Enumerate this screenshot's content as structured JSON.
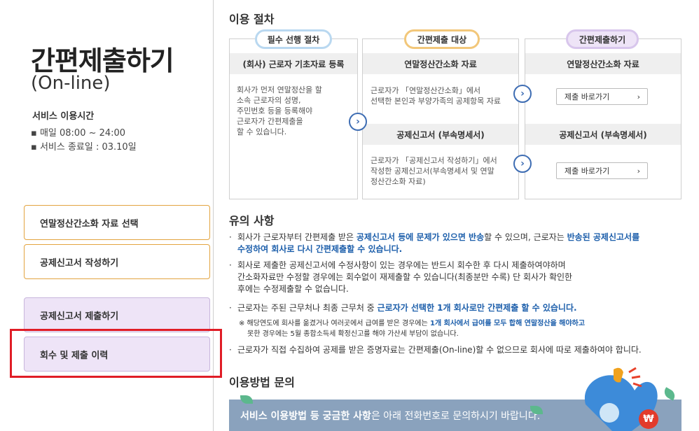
{
  "left": {
    "title": "간편제출하기",
    "subtitle": "(On-line)",
    "service_hours": {
      "heading": "서비스 이용시간",
      "lines": [
        "▪ 매일 08:00 ~ 24:00",
        "▪ 서비스 종료일 : 03.10일"
      ]
    },
    "menu": [
      "연말정산간소화 자료 선택",
      "공제신고서 작성하기",
      "공제신고서 제출하기",
      "회수 및 제출 이력"
    ]
  },
  "procedure": {
    "heading": "이용 절차",
    "pills": [
      "필수 선행 절차",
      "간편제출 대상",
      "간편제출하기"
    ],
    "col1": {
      "head": "(회사) 근로자 기초자료 등록",
      "text": [
        "회사가 먼저 연말정산을 할",
        "소속 근로자의 성명,",
        "주민번호 등을 등록해야",
        "근로자가 간편제출을",
        "할 수 있습니다."
      ]
    },
    "col2": {
      "head1": "연말정산간소화 자료",
      "text1": [
        "근로자가 「연말정산간소화」에서",
        "선택한 본인과 부양가족의 공제항목 자료"
      ],
      "head2": "공제신고서 (부속명세서)",
      "text2": [
        "근로자가 「공제신고서 작성하기」에서",
        "작성한 공제신고서(부속명세서 및 연말",
        "정산간소화 자료)"
      ]
    },
    "col3": {
      "head1": "연말정산간소화 자료",
      "head2": "공제신고서 (부속명세서)",
      "submit_label": "제출 바로가기",
      "chevron": "›"
    }
  },
  "notes": {
    "heading": "유의 사항",
    "n1": {
      "a": "회사가 근로자부터 간편제출 받은 ",
      "b": "공제신고서 등에 문제가 있으면 반송",
      "c": "할 수 있으며, 근로자는 ",
      "d": "반송된 공제신고서를",
      "e": "수정하여 회사로 다시 간편제출할 수 있습니다."
    },
    "n2": [
      "회사로 제출한 공제신고서에 수정사항이 있는 경우에는 반드시 회수한 후 다시 제출하여야하며",
      "간소화자료만 수정할 경우에는 회수없이 재제출할 수 있습니다(최종분만 수록) 단 회사가 확인한",
      "후에는 수정제출할 수 없습니다."
    ],
    "n3": {
      "a": "근로자는 주된 근무처나 최종 근무처 중 ",
      "b": "근로자가 선택한 1개 회사로만 간편제출 할 수 있습니다."
    },
    "fine": {
      "a": "※ 해당연도에 회사를 옮겼거나 여러곳에서 급여를 받은 경우에는 ",
      "b": "1개 회사에서 급여를 모두 합해 연말정산을 해야하고",
      "c": "못한 경우에는 5월 종합소득세 확정신고를 해야 가산세 부담이 없습니다."
    },
    "n4": "근로자가 직접 수집하여 공제를 받은 증명자료는 간편제출(On-line)할 수 없으므로 회사에 따로 제출하여야 합니다.",
    "bullet": "·"
  },
  "inquiry": {
    "heading": "이용방법 문의",
    "banner_bold": "서비스 이용방법 등 궁금한 사항",
    "banner_rest": "은 아래 전화번호로 문의하시기 바랍니다.",
    "badge": "₩"
  },
  "colors": {
    "accent_blue": "#1d5fab",
    "orange_border": "#e3a440",
    "purple_fill": "#eee4f7",
    "highlight_red": "#e01d26"
  },
  "icons": {
    "arrow": "›"
  }
}
